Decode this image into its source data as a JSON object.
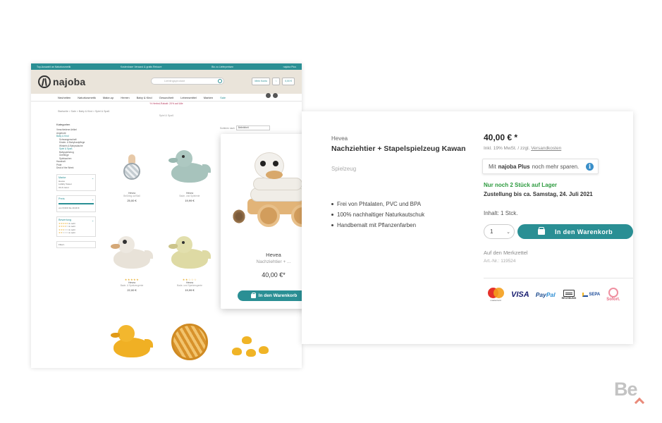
{
  "shop": {
    "topbar": [
      "Top-Auswahl an Naturkosmetik",
      "Kostenloser Versand & gratis Retoure",
      "Bio zu Lieferpreisen",
      "najoba Plus"
    ],
    "logo_text": "najoba",
    "search_placeholder": "Lieblingsprodukt",
    "header_buttons": [
      "Mein Konto",
      "♡",
      "0,00 €"
    ],
    "nav": [
      "Neuheiten",
      "Naturkosmetik",
      "Make-up",
      "Herren",
      "Baby & Kind",
      "Gesundheit",
      "Lebensmittel",
      "Marken",
      "Sale"
    ],
    "promo": "% Herbst-Rabatt: 20% auf Alle",
    "breadcrumb": "Startseite  >  Sale  >  Baby & Kind  >  Spiel & Spaß",
    "category_title": "Spiel & Spaß",
    "sidebar": {
      "heading": "Kategorien",
      "items": [
        "Verschiedene Artikel",
        "Angebote",
        "Baby & Kind"
      ],
      "subitems": [
        "Schwangerschaft",
        "Kinder- & Babyhautpflege",
        "Windeln & Babywäsche",
        "Spiel & Spaß",
        "Babyspielzeug",
        "Greiflinge",
        "Spielsachen"
      ],
      "more_items": [
        "Haushalt",
        "Pride",
        "Deal of the Week"
      ],
      "filter_brand": "Marke",
      "brands": [
        "Hevea",
        "Lullaby Sweet",
        "Oil & Carol"
      ],
      "filter_price": "Preis",
      "price_range": "von 8,99 € bis 40,00 €",
      "filter_rating": "Bewertung",
      "ratings": [
        "& mehr",
        "& mehr",
        "& mehr",
        "& mehr"
      ],
      "filter_reset": "Filtern"
    },
    "sort_label": "Sortieren nach",
    "sort_value": "Beliebtheit",
    "products": [
      {
        "brand": "Hevea",
        "name": "Beißring auf Ball",
        "price": "25,00 €"
      },
      {
        "brand": "Hevea",
        "name": "Bade- und Spielente",
        "price": "19,99 €"
      },
      {
        "brand": "Hevea",
        "name": "Bade- & Spielzeugente",
        "price": "22,00 €"
      },
      {
        "brand": "Hevea",
        "name": "Bade- und Spielzeugente",
        "price": "19,99 €"
      }
    ]
  },
  "card": {
    "brand": "Hevea",
    "name": "Nachziehtier + ...",
    "price": "40,00 €*",
    "cart_label": "In den Warenkorb"
  },
  "detail": {
    "brand": "Hevea",
    "title": "Nachziehtier + Stapelspielzeug Kawan",
    "subtitle": "Spielzeug",
    "features": [
      "Frei von Phtalaten, PVC und BPA",
      "100% nachhaltiger Naturkautschuk",
      "Handbemalt mit Pflanzenfarben"
    ],
    "price": "40,00 € *",
    "vat": "Inkl. 19% MwSt. / zzgl.",
    "vat_link": "Versandkosten",
    "plus_prefix": "Mit",
    "plus_brand": "najoba Plus",
    "plus_suffix": "noch mehr sparen.",
    "stock": "Nur noch 2 Stück auf Lager",
    "delivery": "Zustellung bis ca. Samstag, 24. Juli 2021",
    "content": "Inhalt: 1 Stck.",
    "qty": "1",
    "cart_label": "In den Warenkorb",
    "wishlist": "Auf den Merkzettel",
    "article_label": "Art.-Nr.:",
    "article_no": "119524",
    "payments": {
      "mastercard": "mastercard",
      "visa": "VISA",
      "paypal_pay": "Pay",
      "paypal_pal": "Pal",
      "rechnung": "RECHNUNG",
      "sepa": "SEPA",
      "sofort": "Sofort."
    }
  },
  "watermark": "Be"
}
